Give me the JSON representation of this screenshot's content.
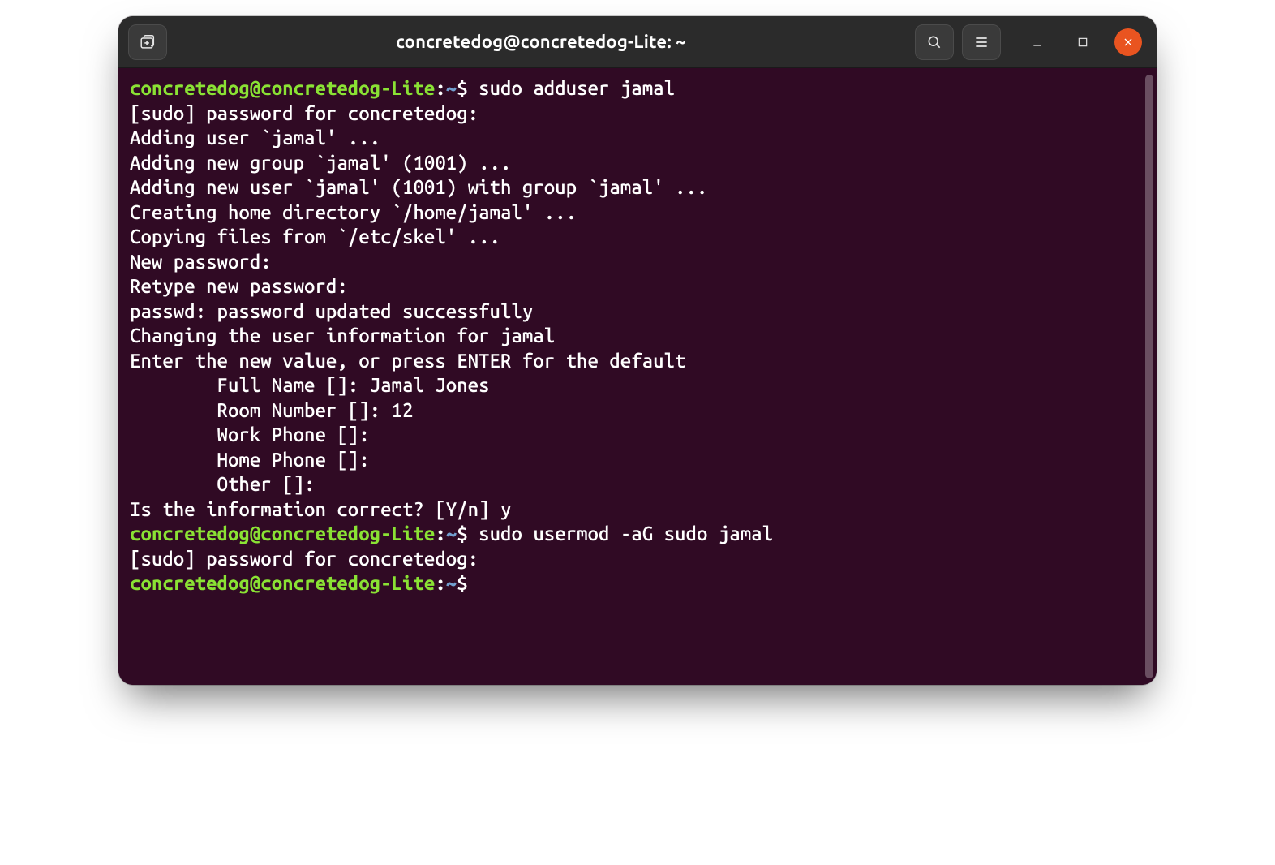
{
  "window": {
    "title": "concretedog@concretedog-Lite: ~"
  },
  "prompt": {
    "user_host": "concretedog@concretedog-Lite",
    "path": "~",
    "sep": ":",
    "symbol": "$"
  },
  "terminal": {
    "lines": [
      {
        "type": "prompt",
        "cmd": "sudo adduser jamal"
      },
      {
        "type": "out",
        "text": "[sudo] password for concretedog: "
      },
      {
        "type": "out",
        "text": "Adding user `jamal' ..."
      },
      {
        "type": "out",
        "text": "Adding new group `jamal' (1001) ..."
      },
      {
        "type": "out",
        "text": "Adding new user `jamal' (1001) with group `jamal' ..."
      },
      {
        "type": "out",
        "text": "Creating home directory `/home/jamal' ..."
      },
      {
        "type": "out",
        "text": "Copying files from `/etc/skel' ..."
      },
      {
        "type": "out",
        "text": "New password: "
      },
      {
        "type": "out",
        "text": "Retype new password: "
      },
      {
        "type": "out",
        "text": "passwd: password updated successfully"
      },
      {
        "type": "out",
        "text": "Changing the user information for jamal"
      },
      {
        "type": "out",
        "text": "Enter the new value, or press ENTER for the default"
      },
      {
        "type": "out",
        "text": "        Full Name []: Jamal Jones"
      },
      {
        "type": "out",
        "text": "        Room Number []: 12"
      },
      {
        "type": "out",
        "text": "        Work Phone []: "
      },
      {
        "type": "out",
        "text": "        Home Phone []: "
      },
      {
        "type": "out",
        "text": "        Other []: "
      },
      {
        "type": "out",
        "text": "Is the information correct? [Y/n] y"
      },
      {
        "type": "prompt",
        "cmd": "sudo usermod -aG sudo jamal"
      },
      {
        "type": "out",
        "text": "[sudo] password for concretedog: "
      },
      {
        "type": "prompt",
        "cmd": ""
      }
    ]
  },
  "colors": {
    "bg": "#300a24",
    "titlebar": "#2b2b2b",
    "user": "#8ae234",
    "path": "#729fcf",
    "close": "#e95420"
  }
}
